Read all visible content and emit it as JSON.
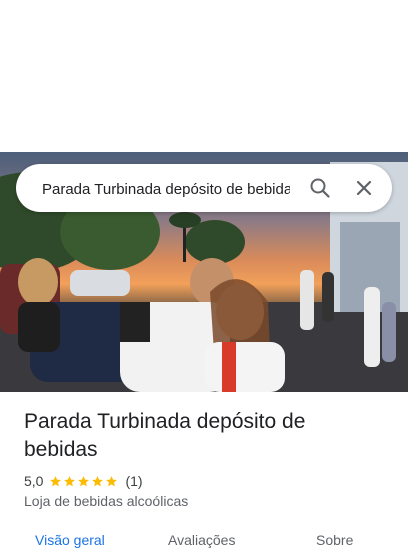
{
  "search": {
    "value": "Parada Turbinada depósito de bebidas"
  },
  "place": {
    "title": "Parada Turbinada depósito de bebidas",
    "rating": "5,0",
    "stars": 5,
    "review_count": "(1)",
    "category": "Loja de bebidas alcoólicas"
  },
  "tabs": [
    {
      "label": "Visão geral",
      "active": true
    },
    {
      "label": "Avaliações",
      "active": false
    },
    {
      "label": "Sobre",
      "active": false
    }
  ],
  "colors": {
    "accent": "#1a73e8",
    "star": "#fbbc04",
    "text_primary": "#202124",
    "text_secondary": "#5f6368"
  },
  "icons": {
    "search": "search-icon",
    "close": "close-icon",
    "star": "star-icon"
  }
}
